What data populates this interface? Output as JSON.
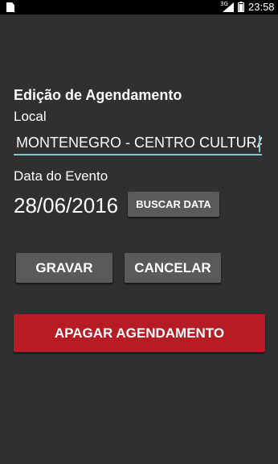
{
  "status_bar": {
    "time": "23:58",
    "network": "3G",
    "icons": [
      "sd-card-icon",
      "signal-icon",
      "battery-icon"
    ]
  },
  "form": {
    "title": "Edição de Agendamento",
    "local_label": "Local",
    "local_value": "MONTENEGRO - CENTRO CULTURAL",
    "date_label": "Data do Evento",
    "date_value": "28/06/2016"
  },
  "buttons": {
    "search_date": "BUSCAR DATA",
    "save": "GRAVAR",
    "cancel": "CANCELAR",
    "delete": "APAGAR AGENDAMENTO"
  },
  "colors": {
    "background": "#303030",
    "button": "#5a5a5a",
    "danger": "#b71c25",
    "accent": "#80cbc4"
  }
}
